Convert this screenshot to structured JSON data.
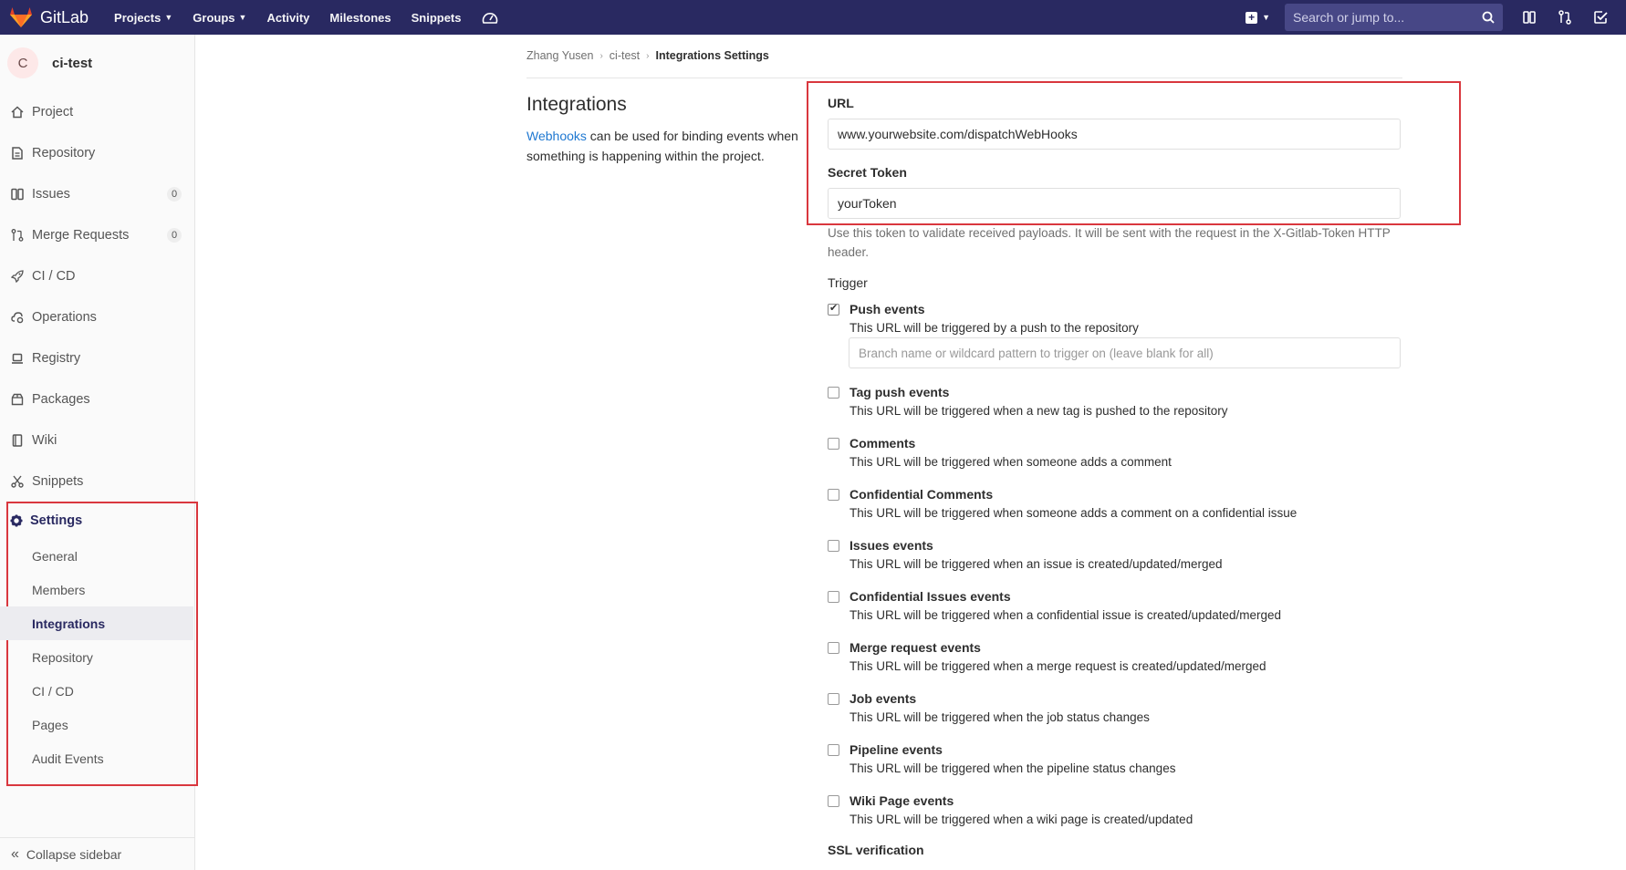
{
  "topbar": {
    "brand": "GitLab",
    "nav": [
      {
        "label": "Projects",
        "dropdown": true
      },
      {
        "label": "Groups",
        "dropdown": true
      },
      {
        "label": "Activity",
        "dropdown": false
      },
      {
        "label": "Milestones",
        "dropdown": false
      },
      {
        "label": "Snippets",
        "dropdown": false
      }
    ],
    "search_placeholder": "Search or jump to..."
  },
  "sidebar": {
    "avatar_letter": "C",
    "project_name": "ci-test",
    "items": [
      {
        "label": "Project",
        "icon": "home-icon"
      },
      {
        "label": "Repository",
        "icon": "doc-icon"
      },
      {
        "label": "Issues",
        "icon": "issues-icon",
        "count": "0"
      },
      {
        "label": "Merge Requests",
        "icon": "merge-icon",
        "count": "0"
      },
      {
        "label": "CI / CD",
        "icon": "rocket-icon"
      },
      {
        "label": "Operations",
        "icon": "cloud-gear-icon"
      },
      {
        "label": "Registry",
        "icon": "laptop-icon"
      },
      {
        "label": "Packages",
        "icon": "package-icon"
      },
      {
        "label": "Wiki",
        "icon": "book-icon"
      },
      {
        "label": "Snippets",
        "icon": "scissors-icon"
      }
    ],
    "settings": {
      "label": "Settings",
      "sub_items": [
        "General",
        "Members",
        "Integrations",
        "Repository",
        "CI / CD",
        "Pages",
        "Audit Events"
      ],
      "active": "Integrations"
    },
    "collapse_label": "Collapse sidebar"
  },
  "breadcrumb": [
    "Zhang Yusen",
    "ci-test",
    "Integrations Settings"
  ],
  "page": {
    "title": "Integrations",
    "desc_link": "Webhooks",
    "desc_rest": " can be used for binding events when something is happening within the project."
  },
  "form": {
    "url_label": "URL",
    "url_value": "www.yourwebsite.com/dispatchWebHooks",
    "token_label": "Secret Token",
    "token_value": "yourToken",
    "token_help": "Use this token to validate received payloads. It will be sent with the request in the X-Gitlab-Token HTTP header.",
    "trigger_label": "Trigger",
    "branch_placeholder": "Branch name or wildcard pattern to trigger on (leave blank for all)",
    "events": [
      {
        "name": "Push events",
        "desc": "This URL will be triggered by a push to the repository",
        "checked": true
      },
      {
        "name": "Tag push events",
        "desc": "This URL will be triggered when a new tag is pushed to the repository",
        "checked": false
      },
      {
        "name": "Comments",
        "desc": "This URL will be triggered when someone adds a comment",
        "checked": false
      },
      {
        "name": "Confidential Comments",
        "desc": "This URL will be triggered when someone adds a comment on a confidential issue",
        "checked": false
      },
      {
        "name": "Issues events",
        "desc": "This URL will be triggered when an issue is created/updated/merged",
        "checked": false
      },
      {
        "name": "Confidential Issues events",
        "desc": "This URL will be triggered when a confidential issue is created/updated/merged",
        "checked": false
      },
      {
        "name": "Merge request events",
        "desc": "This URL will be triggered when a merge request is created/updated/merged",
        "checked": false
      },
      {
        "name": "Job events",
        "desc": "This URL will be triggered when the job status changes",
        "checked": false
      },
      {
        "name": "Pipeline events",
        "desc": "This URL will be triggered when the pipeline status changes",
        "checked": false
      },
      {
        "name": "Wiki Page events",
        "desc": "This URL will be triggered when a wiki page is created/updated",
        "checked": false
      }
    ],
    "ssl_label": "SSL verification"
  }
}
